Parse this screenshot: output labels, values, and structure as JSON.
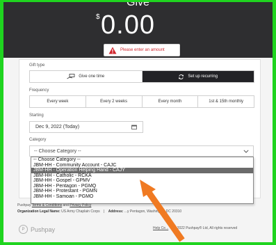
{
  "hero": {
    "title": "Give",
    "currency": "$",
    "amount": "0.00"
  },
  "error": {
    "message": "Please enter an amount",
    "icon": "warning-icon",
    "color": "#d0262d"
  },
  "gift_type": {
    "label": "Gift type",
    "options": [
      "Give one time",
      "Set up recurring"
    ],
    "selected": "Set up recurring"
  },
  "frequency": {
    "label": "Frequency",
    "options": [
      "Every week",
      "Every 2 weeks",
      "Every month",
      "1st & 15th monthly"
    ]
  },
  "starting": {
    "label": "Starting",
    "value": "Dec 9, 2022 (Today)"
  },
  "category": {
    "label": "Category",
    "value": "-- Choose Category --",
    "options": [
      "-- Choose Category --",
      "JBM-HH - Community Account - CAJC",
      "JBM-HH - Operation Helping Hand - CAJY",
      "JBM-HH - Catholic - RCKA",
      "JBM-HH - Gospel - GPMV",
      "JBM-HH - Pentagon - PGMQ",
      "JBM-HH - Protestant - PGMN",
      "JBM-HH - Samoan - PGMO"
    ],
    "highlighted_index": 2
  },
  "footer": {
    "pushpay_prefix": "Pushpay",
    "terms_link": "Terms & Conditions",
    "and": "and",
    "privacy_link": "Privacy Policy",
    "legal_label": "Organization Legal Name:",
    "legal_value": "US Army Chaplain Corps",
    "address_label": "Address:",
    "address_value": "...y Pentagon, Washington DC 20310",
    "logo_text": "Pushpay",
    "help_link": "Help Ce...",
    "copyright": "© 2022 Pushpay® Ltd, All rights reserved"
  },
  "colors": {
    "frame_border": "#1fd41f",
    "hero_bg": "#2e2e30",
    "arrow": "#f07a22",
    "selected_toggle": "#222226"
  }
}
